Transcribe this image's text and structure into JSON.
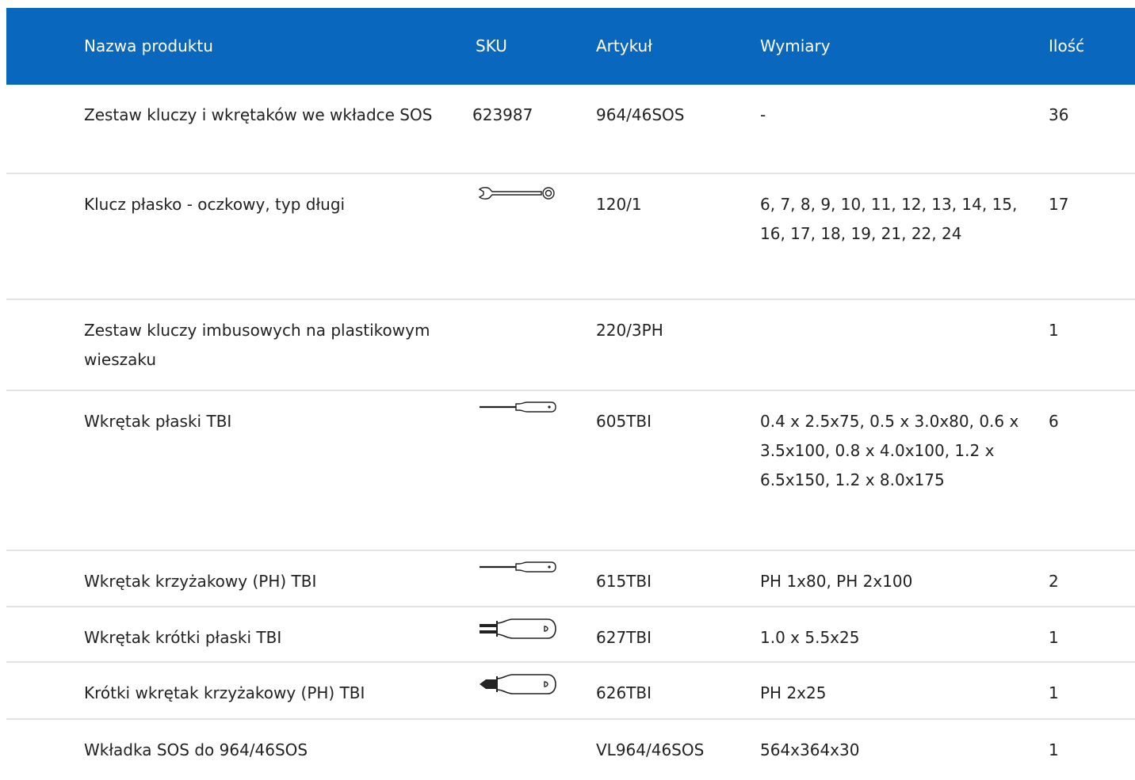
{
  "table": {
    "headers": {
      "name": "Nazwa produktu",
      "sku": "SKU",
      "article": "Artykuł",
      "dimensions": "Wymiary",
      "quantity": "Ilość"
    },
    "rows": [
      {
        "name": "Zestaw kluczy i wkrętaków we wkładce SOS",
        "sku": "623987",
        "icon": null,
        "article": "964/46SOS",
        "dimensions": "-",
        "quantity": "36"
      },
      {
        "name": "Klucz płasko - oczkowy, typ długi",
        "sku": "",
        "icon": "combination-wrench-icon",
        "article": "120/1",
        "dimensions": "6, 7, 8, 9, 10, 11, 12, 13, 14, 15, 16, 17, 18, 19, 21, 22, 24",
        "quantity": "17"
      },
      {
        "name": "Zestaw kluczy imbusowych na plastikowym wieszaku",
        "sku": "",
        "icon": null,
        "article": "220/3PH",
        "dimensions": "",
        "quantity": "1"
      },
      {
        "name": "Wkrętak płaski TBI",
        "sku": "",
        "icon": "flat-screwdriver-icon",
        "article": "605TBI",
        "dimensions": "0.4 x 2.5x75, 0.5 x 3.0x80, 0.6 x 3.5x100, 0.8 x 4.0x100, 1.2 x 6.5x150, 1.2 x 8.0x175",
        "quantity": "6"
      },
      {
        "name": "Wkrętak krzyżakowy (PH) TBI",
        "sku": "",
        "icon": "phillips-screwdriver-icon",
        "article": "615TBI",
        "dimensions": "PH 1x80, PH 2x100",
        "quantity": "2"
      },
      {
        "name": "Wkrętak krótki płaski TBI",
        "sku": "",
        "icon": "short-flat-screwdriver-icon",
        "article": "627TBI",
        "dimensions": "1.0 x 5.5x25",
        "quantity": "1"
      },
      {
        "name": "Krótki wkrętak krzyżakowy (PH) TBI",
        "sku": "",
        "icon": "short-phillips-screwdriver-icon",
        "article": "626TBI",
        "dimensions": "PH 2x25",
        "quantity": "1"
      },
      {
        "name": "Wkładka SOS do 964/46SOS",
        "sku": "",
        "icon": null,
        "article": "VL964/46SOS",
        "dimensions": "564x364x30",
        "quantity": "1"
      }
    ]
  },
  "colors": {
    "header_bg": "#0a67be",
    "header_text": "#ffffff",
    "row_divider": "#e4e4e4"
  }
}
